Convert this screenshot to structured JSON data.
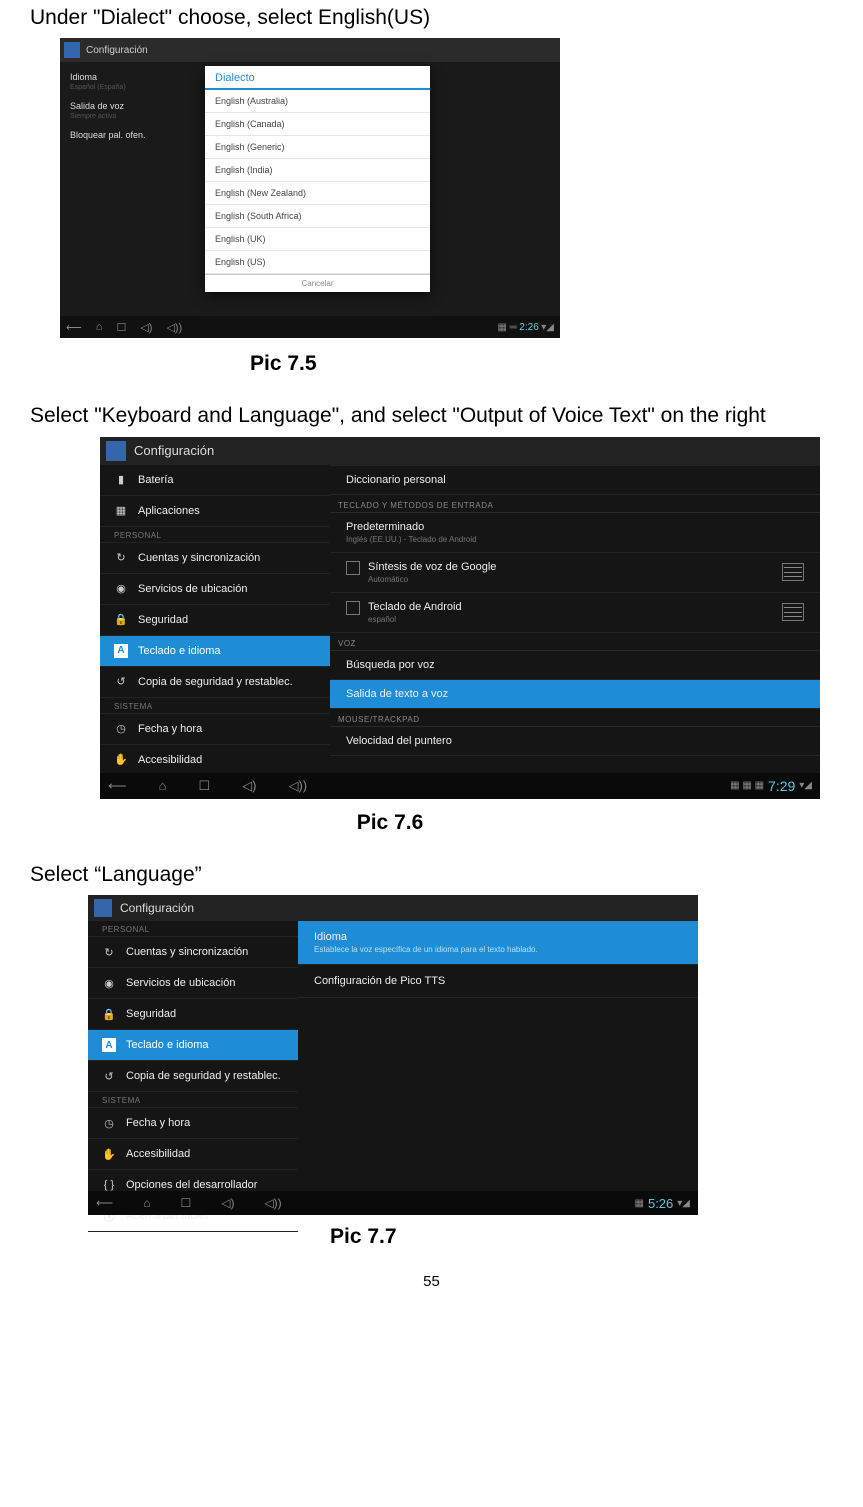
{
  "text": {
    "instr1": "Under \"Dialect\" choose, select English(US)",
    "cap1": "Pic 7.5",
    "instr2": "Select \"Keyboard and Language\", and select \"Output of Voice Text\" on the right",
    "cap2": "Pic 7.6",
    "instr3": "Select “Language”",
    "cap3": "Pic 7.7",
    "pagenum": "55"
  },
  "shot1": {
    "topbar": "Configuración",
    "leftItems": [
      {
        "label": "Idioma",
        "sub": "Español (España)"
      },
      {
        "label": "Salida de voz",
        "sub": "Siempre activa"
      },
      {
        "label": "Bloquear pal. ofen."
      }
    ],
    "dialogTitle": "Dialecto",
    "dialogItems": [
      "English (Australia)",
      "English (Canada)",
      "English (Generic)",
      "English (India)",
      "English (New Zealand)",
      "English (South Africa)",
      "English (UK)",
      "English (US)"
    ],
    "dialogFooter": "Cancelar",
    "clock": "2:26"
  },
  "shot2": {
    "topbar": "Configuración",
    "left": {
      "items_top": [
        {
          "icon": "battery",
          "label": "Batería"
        },
        {
          "icon": "apps",
          "label": "Aplicaciones"
        }
      ],
      "cat1": "PERSONAL",
      "items_personal": [
        {
          "icon": "sync",
          "label": "Cuentas y sincronización"
        },
        {
          "icon": "location",
          "label": "Servicios de ubicación"
        },
        {
          "icon": "lock",
          "label": "Seguridad"
        },
        {
          "icon": "A",
          "label": "Teclado e idioma",
          "selected": true
        },
        {
          "icon": "backup",
          "label": "Copia de seguridad y restablec."
        }
      ],
      "cat2": "SISTEMA",
      "items_system": [
        {
          "icon": "clock",
          "label": "Fecha y hora"
        },
        {
          "icon": "hand",
          "label": "Accesibilidad"
        }
      ]
    },
    "right": {
      "head0": "Diccionario personal",
      "head1": "TECLADO Y MÉTODOS DE ENTRADA",
      "rows1": [
        {
          "label": "Predeterminado",
          "sub": "Inglés (EE.UU.) - Teclado de Android"
        },
        {
          "label": "Síntesis de voz de Google",
          "sub": "Automático",
          "check": true,
          "sliders": true
        },
        {
          "label": "Teclado de Android",
          "sub": "español",
          "check": true,
          "sliders": true
        }
      ],
      "head2": "VOZ",
      "rows2": [
        {
          "label": "Búsqueda por voz"
        },
        {
          "label": "Salida de texto a voz",
          "selected": true
        }
      ],
      "head3": "MOUSE/TRACKPAD",
      "rows3": [
        {
          "label": "Velocidad del puntero"
        }
      ]
    },
    "clock": "7:29"
  },
  "shot3": {
    "topbar": "Configuración",
    "left": {
      "cat1": "PERSONAL",
      "items_personal": [
        {
          "icon": "sync",
          "label": "Cuentas y sincronización"
        },
        {
          "icon": "location",
          "label": "Servicios de ubicación"
        },
        {
          "icon": "lock",
          "label": "Seguridad"
        },
        {
          "icon": "A",
          "label": "Teclado e idioma",
          "selected": true
        },
        {
          "icon": "backup",
          "label": "Copia de seguridad y restablec."
        }
      ],
      "cat2": "SISTEMA",
      "items_system": [
        {
          "icon": "clock",
          "label": "Fecha y hora"
        },
        {
          "icon": "hand",
          "label": "Accesibilidad"
        },
        {
          "icon": "dev",
          "label": "Opciones del desarrollador"
        },
        {
          "icon": "info",
          "label": "Acerca del tablet"
        }
      ]
    },
    "right": {
      "rows": [
        {
          "label": "Idioma",
          "sub": "Establece la voz específica de un idioma para el texto hablado.",
          "selected": true
        },
        {
          "label": "Configuración de Pico TTS"
        }
      ]
    },
    "clock": "5:26"
  }
}
